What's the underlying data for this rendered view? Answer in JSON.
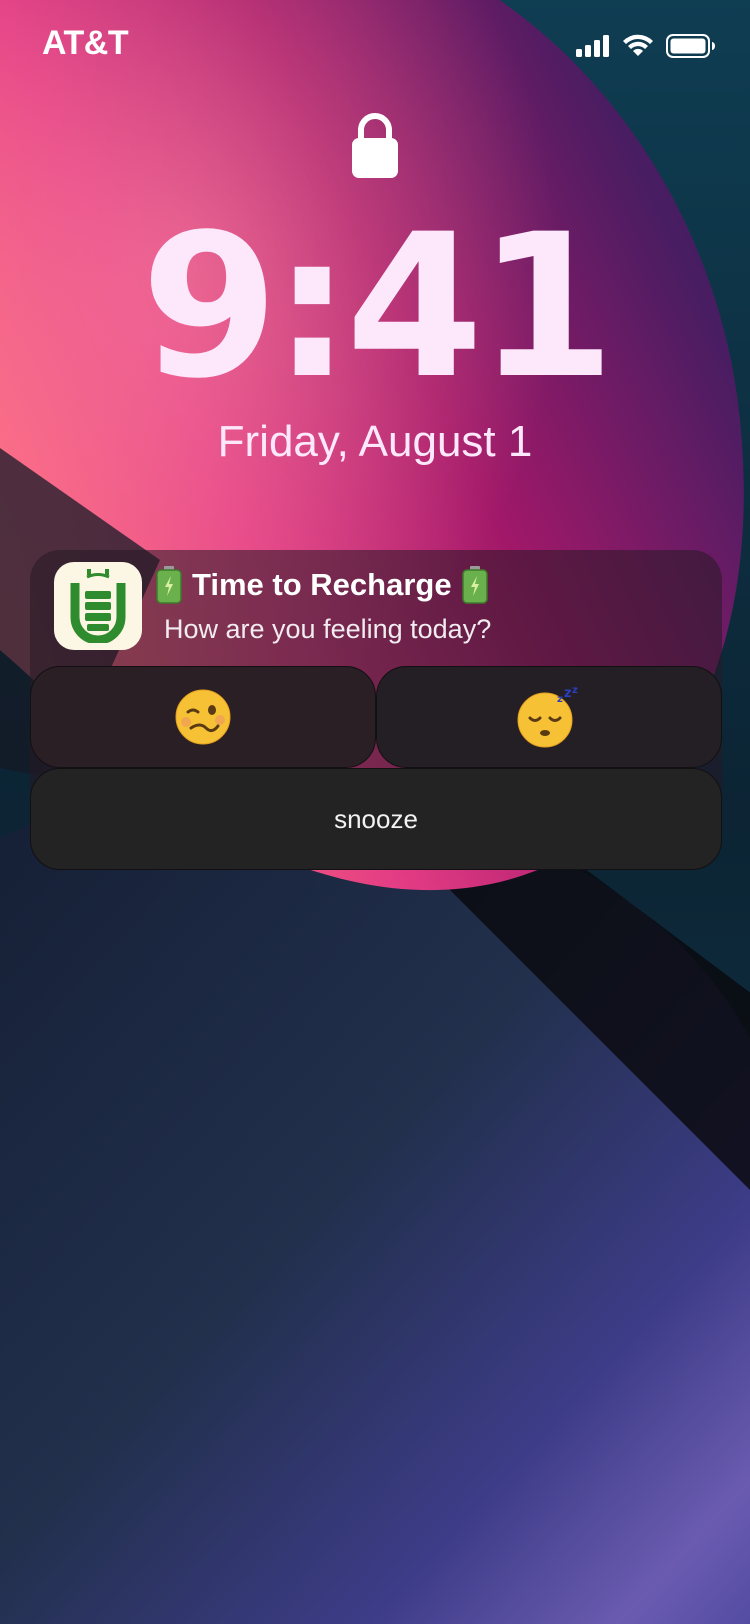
{
  "status_bar": {
    "carrier": "AT&T",
    "icons": [
      "cellular-signal-icon",
      "wifi-icon",
      "battery-icon"
    ]
  },
  "lock_screen": {
    "lock_icon": "lock-icon",
    "time": "9:41",
    "date": "Friday, August 1"
  },
  "notification": {
    "app_icon": "recharge-app-icon",
    "title": "Time to Recharge",
    "title_icons": [
      "battery-emoji",
      "battery-emoji"
    ],
    "body": "How are you feeling today?",
    "actions": [
      {
        "icon": "woozy-face-emoji",
        "label": ""
      },
      {
        "icon": "sleeping-face-emoji",
        "label": ""
      },
      {
        "icon": "",
        "label": "snooze"
      }
    ]
  },
  "colors": {
    "clock_text": "#fde8fb",
    "app_icon_bg": "#fbf7e4",
    "app_icon_fg": "#2e8b2e",
    "notification_bg": "#261a24"
  }
}
